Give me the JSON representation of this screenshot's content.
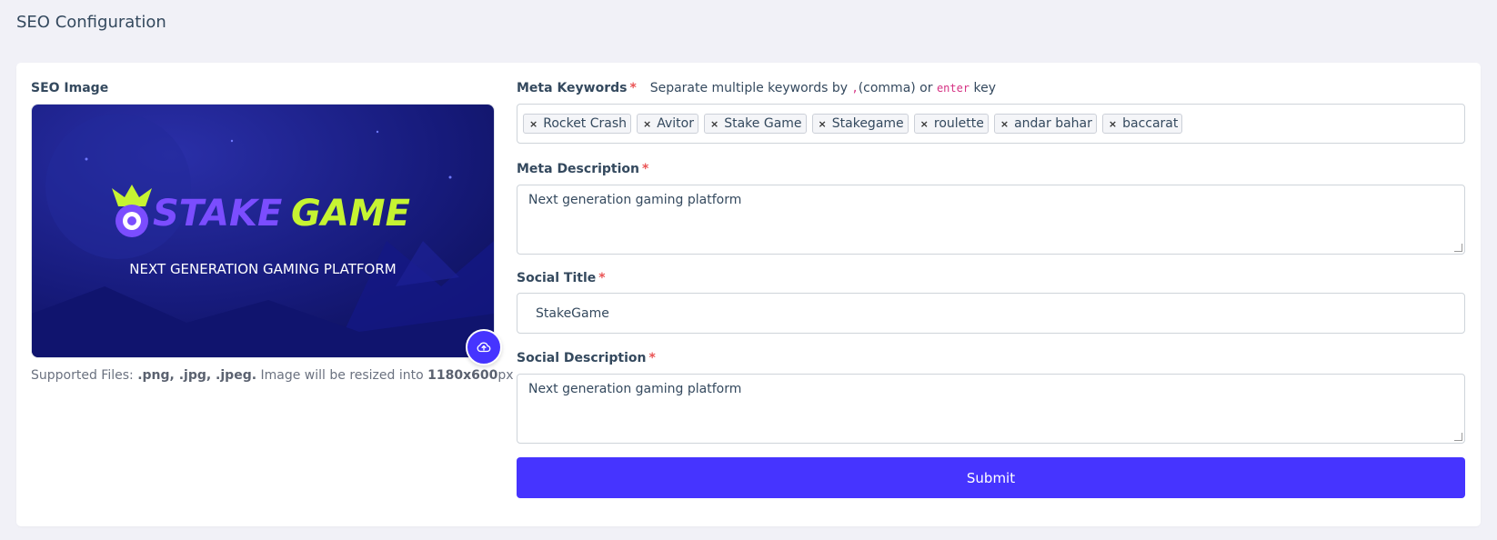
{
  "page": {
    "title": "SEO Configuration"
  },
  "seo_image": {
    "label": "SEO Image",
    "banner_logo_part1": "STAKE",
    "banner_logo_part2": "GAME",
    "banner_tagline": "NEXT GENERATION GAMING PLATFORM",
    "supported_prefix": "Supported Files: ",
    "supported_types": ".png, .jpg, .jpeg.",
    "resize_text": " Image will be resized into ",
    "resize_size": "1180x600",
    "resize_unit": "px",
    "upload_icon": "cloud-upload-icon"
  },
  "meta_keywords": {
    "label": "Meta Keywords",
    "required_mark": "*",
    "hint_prefix": "Separate multiple keywords by ",
    "hint_comma_code": ",",
    "hint_middle": "(comma) or ",
    "hint_enter_code": "enter",
    "hint_suffix": " key",
    "remove_symbol": "×",
    "tags": [
      "Rocket Crash",
      "Avitor",
      "Stake Game",
      "Stakegame",
      "roulette",
      "andar bahar",
      "baccarat"
    ]
  },
  "meta_description": {
    "label": "Meta Description",
    "required_mark": "*",
    "value": "Next generation gaming platform"
  },
  "social_title": {
    "label": "Social Title",
    "required_mark": "*",
    "value": "StakeGame"
  },
  "social_description": {
    "label": "Social Description",
    "required_mark": "*",
    "value": "Next generation gaming platform"
  },
  "submit": {
    "label": "Submit"
  },
  "colors": {
    "primary": "#4634ff",
    "required": "#ea5455",
    "logo_purple": "#7b4dff",
    "logo_lime": "#c6f432",
    "banner_bg": "#1a1f8a"
  }
}
